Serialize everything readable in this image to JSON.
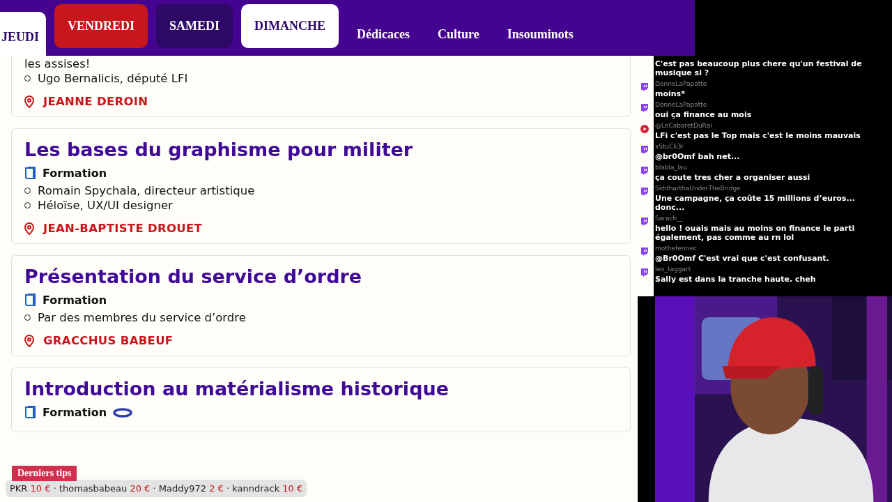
{
  "nav": {
    "days": [
      {
        "label": "JEUDI",
        "selected": true,
        "color": "#ffffff"
      },
      {
        "label": "VENDREDI",
        "selected": false,
        "color": "#c8161d"
      },
      {
        "label": "SAMEDI",
        "selected": false,
        "color": "#2e0866"
      },
      {
        "label": "DIMANCHE",
        "selected": false,
        "color": "#ffffff"
      }
    ],
    "links": [
      "Dédicaces",
      "Culture",
      "Insouminots"
    ]
  },
  "sessions": [
    {
      "speakers": [
        "les assises!",
        "Ugo Bernalicis, député LFI"
      ],
      "location": "JEANNE DEROIN"
    },
    {
      "title": "Les bases du graphisme pour militer",
      "type": "Formation",
      "speakers": [
        "Romain Spychala, directeur artistique",
        "Héloïse, UX/UI designer"
      ],
      "location": "JEAN-BAPTISTE DROUET"
    },
    {
      "title": "Présentation du service d’ordre",
      "type": "Formation",
      "speakers": [
        "Par des membres du service d’ordre"
      ],
      "location": "GRACCHUS BABEUF"
    },
    {
      "title": "Introduction au matérialisme historique",
      "type": "Formation"
    }
  ],
  "chat": [
    {
      "text": "C'est pas beaucoup plus chere qu'un festival de musique si ?"
    },
    {
      "kind": "twitch",
      "user": "DonneLaPapatte",
      "text": "moins*"
    },
    {
      "kind": "twitch",
      "user": "DonneLaPapatte",
      "text": "oui ça finance au mois"
    },
    {
      "kind": "youtube",
      "user": "@LeCabaretDuRai",
      "text": "LFi c'est pas le Top mais c'est le moins mauvais"
    },
    {
      "kind": "twitch",
      "user": "xStuCk3r",
      "text": "@br0Omf bah net..."
    },
    {
      "kind": "twitch",
      "user": "blabla_lau",
      "text": "ça coute tres cher a organiser aussi"
    },
    {
      "kind": "twitch",
      "user": "SiddharthaUnderTheBridge",
      "text": "Une campagne, ça coûte 15 millions d’euros... donc..."
    },
    {
      "kind": "twitch",
      "user": "Sarach__",
      "text": "hello ! ouais mais au moins on finance le parti également, pas comme au rn lol"
    },
    {
      "kind": "twitch",
      "user": "mothefennec",
      "text": "@Br0Omf C'est vrai que c'est confusant."
    },
    {
      "kind": "twitch",
      "user": "leo_taggart",
      "text": "Sally est dans la tranche haute. cheh"
    }
  ],
  "tips": {
    "title": "Derniers tips",
    "items": [
      {
        "name": "PKR",
        "amount": "10 €"
      },
      {
        "name": "thomasbabeau",
        "amount": "20 €"
      },
      {
        "name": "Maddy972",
        "amount": "2 €"
      },
      {
        "name": "kanndrack",
        "amount": "10 €"
      }
    ],
    "separator": "·"
  }
}
